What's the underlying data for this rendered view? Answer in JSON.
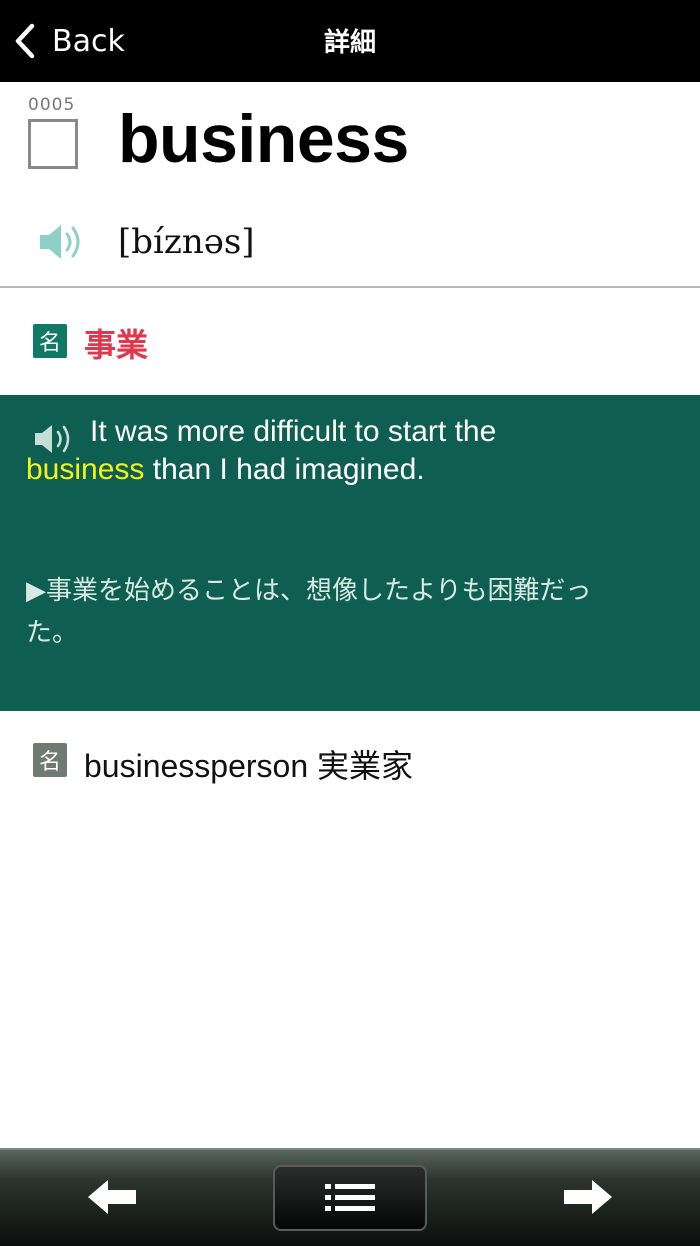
{
  "header": {
    "back_label": "Back",
    "title": "詳細"
  },
  "entry": {
    "number": "0005",
    "word": "business",
    "pronunciation": "[bíznəs]",
    "meanings": [
      {
        "pos": "名",
        "text": "事業"
      }
    ],
    "example": {
      "line1": "It was more difficult to start the",
      "highlight": "business",
      "line2_rest": " than I had imagined.",
      "translation_line1": "▶事業を始めることは、想像したよりも困難だっ",
      "translation_line2": "た。"
    },
    "derivatives": [
      {
        "pos": "名",
        "text": "businessperson 実業家"
      }
    ]
  },
  "colors": {
    "header_bg": "#000000",
    "meaning_text": "#e0374c",
    "example_bg": "#0e5e51",
    "highlight": "#f7f21a",
    "pos_badge": "#117a66"
  },
  "icons": {
    "back": "chevron-left-icon",
    "speaker": "speaker-icon",
    "prev": "arrow-left-icon",
    "next": "arrow-right-icon",
    "list": "list-icon"
  }
}
